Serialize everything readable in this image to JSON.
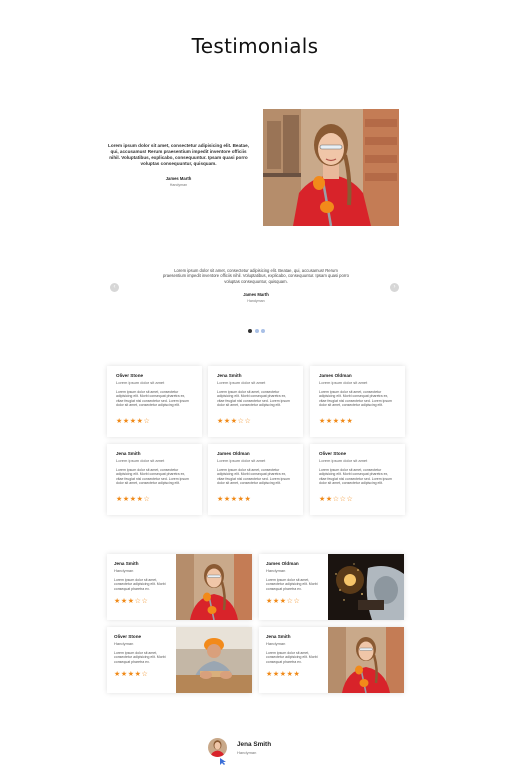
{
  "page": {
    "title": "Testimonials"
  },
  "featured": {
    "quote": "Lorem ipsum dolor sit amet, consectetur adipisicing elit. Beatae, qui, accusamus! Rerum praesentium impedit inventore officiis nihil. Voluptatibus, explicabo, consequuntur. Ipsam quasi porro voluptas consequuntur, quisquam.",
    "name": "James Marth",
    "role": "Handyman",
    "photo_icon": "woman-worker-photo"
  },
  "slider": {
    "quote": "Lorem ipsum dolor sit amet, consectetur adipisicing elit. Beatae, qui, accusamus! Rerum praesentium impedit inventore officiis nihil. Voluptatibus, explicabo, consequuntur. Ipsam quasi porro voluptas consequuntur, quisquam.",
    "name": "James Marth",
    "role": "Handyman",
    "prev_icon": "chevron-left-icon",
    "next_icon": "chevron-right-icon",
    "dots": 3,
    "active_dot": 0
  },
  "cards": [
    {
      "name": "Oliver Stone",
      "sub": "Lorem ipsum dolor sit amet",
      "body": "Lorem ipsum dolor sit amet, consectetur adipisicing elit. Morbi consequat pharetra ex, vitae feugiat nisl consectetur sed. Lorem ipsum dolor sit amet, consectetur adipiscing elit.",
      "rating": 4
    },
    {
      "name": "Jena Smith",
      "sub": "Lorem ipsum dolor sit amet",
      "body": "Lorem ipsum dolor sit amet, consectetur adipisicing elit. Morbi consequat pharetra ex, vitae feugiat nisl consectetur sed. Lorem ipsum dolor sit amet, consectetur adipiscing elit.",
      "rating": 3
    },
    {
      "name": "James Oldman",
      "sub": "Lorem ipsum dolor sit amet",
      "body": "Lorem ipsum dolor sit amet, consectetur adipisicing elit. Morbi consequat pharetra ex, vitae feugiat nisl consectetur sed. Lorem ipsum dolor sit amet, consectetur adipiscing elit.",
      "rating": 5
    },
    {
      "name": "Jena Smith",
      "sub": "Lorem ipsum dolor sit amet",
      "body": "Lorem ipsum dolor sit amet, consectetur adipisicing elit. Morbi consequat pharetra ex, vitae feugiat nisl consectetur sed. Lorem ipsum dolor sit amet, consectetur adipiscing elit.",
      "rating": 4
    },
    {
      "name": "James Oldman",
      "sub": "Lorem ipsum dolor sit amet",
      "body": "Lorem ipsum dolor sit amet, consectetur adipisicing elit. Morbi consequat pharetra ex, vitae feugiat nisl consectetur sed. Lorem ipsum dolor sit amet, consectetur adipiscing elit.",
      "rating": 5
    },
    {
      "name": "Oliver Stone",
      "sub": "Lorem ipsum dolor sit amet",
      "body": "Lorem ipsum dolor sit amet, consectetur adipisicing elit. Morbi consequat pharetra ex, vitae feugiat nisl consectetur sed. Lorem ipsum dolor sit amet, consectetur adipiscing elit.",
      "rating": 2
    }
  ],
  "image_cards": [
    {
      "name": "Jena Smith",
      "role": "Handyman",
      "body": "Lorem ipsum dolor sit amet, consectetur adipisicing elit. Morbi consequat pharetra ex.",
      "rating": 3,
      "photo": "woman-worker-photo"
    },
    {
      "name": "James Oldman",
      "role": "Handyman",
      "body": "Lorem ipsum dolor sit amet, consectetur adipisicing elit. Morbi consequat pharetra ex.",
      "rating": 3,
      "photo": "welding-photo"
    },
    {
      "name": "Oliver Stone",
      "role": "Handyman",
      "body": "Lorem ipsum dolor sit amet, consectetur adipisicing elit. Morbi consequat pharetra ex.",
      "rating": 4,
      "photo": "carpenter-photo"
    },
    {
      "name": "Jena Smith",
      "role": "Handyman",
      "body": "Lorem ipsum dolor sit amet, consectetur adipisicing elit. Morbi consequat pharetra ex.",
      "rating": 5,
      "photo": "woman-worker-photo"
    }
  ],
  "author": {
    "name": "Jena Smith",
    "role": "Handyman"
  },
  "colors": {
    "star": "#f08a19",
    "jacket": "#d8232a",
    "glove": "#f28a1a",
    "dot_active": "#333333",
    "dot": "#a9c0e6"
  }
}
